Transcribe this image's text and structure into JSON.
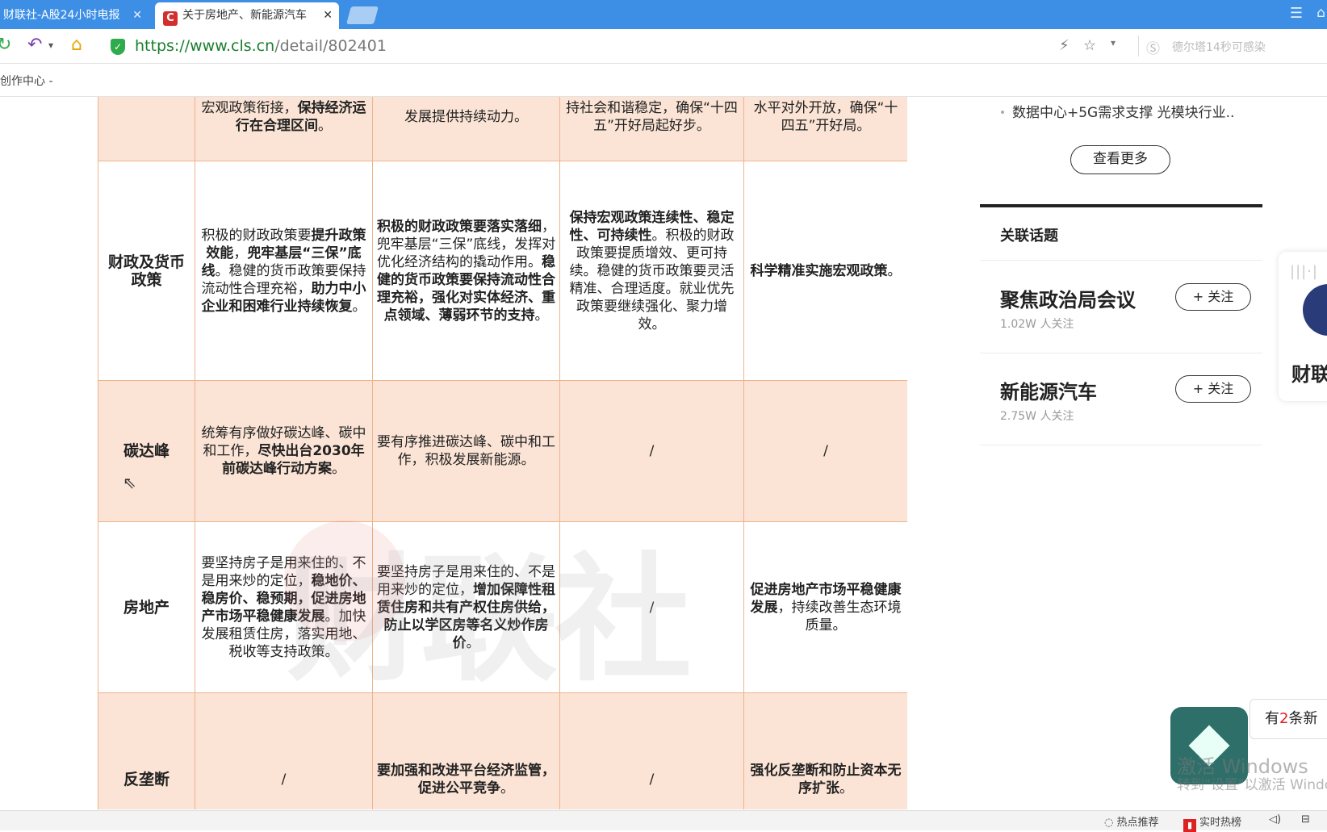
{
  "browser": {
    "tabs": [
      {
        "label": "财联社-A股24小时电报",
        "active": false
      },
      {
        "label": "关于房地产、新能源汽车",
        "active": true
      }
    ],
    "favicon_letter": "C",
    "url_scheme": "https://",
    "url_host": "www.cls.cn",
    "url_path": "/detail/802401",
    "address_hint": "德尔塔14秒可感染",
    "bookmark": "创作中心 -"
  },
  "table": {
    "rows": [
      {
        "label": "",
        "cells": [
          "宏观政策衔接，<b>保持经济运行在合理区间</b>。",
          "发展提供持续动力。",
          "持社会和谐稳定，确保“十四五”开好局起好步。",
          "水平对外开放，确保“十四五”开好局。"
        ],
        "shade": true
      },
      {
        "label": "财政及货币政策",
        "cells": [
          "积极的财政政策要<b>提升政策效能</b>，<b>兜牢基层“三保”底线</b>。稳健的货币政策要保持流动性合理充裕，<b>助力中小企业和困难行业持续恢复</b>。",
          "<b>积极的财政政策要落实落细</b>，兜牢基层“三保”底线，发挥对优化经济结构的撬动作用。<b>稳健的货币政策要保持流动性合理充裕，强化对实体经济、重点领域、薄弱环节的支持</b>。",
          "<b>保持宏观政策连续性、稳定性、可持续性</b>。积极的财政政策要提质增效、更可持续。稳健的货币政策要灵活精准、合理适度。就业优先政策要继续强化、聚力增效。",
          "<b>科学精准实施宏观政策</b>。"
        ],
        "shade": false
      },
      {
        "label": "碳达峰",
        "cells": [
          "统筹有序做好碳达峰、碳中和工作，<b>尽快出台2030年前碳达峰行动方案</b>。",
          "要有序推进碳达峰、碳中和工作，积极发展新能源。",
          "/",
          "/"
        ],
        "shade": true
      },
      {
        "label": "房地产",
        "cells": [
          "要坚持房子是用来住的、不是用来炒的定位，<b>稳地价、稳房价、稳预期，促进房地产市场平稳健康发展</b>。加快发展租赁住房，落实用地、税收等支持政策。",
          "要坚持房子是用来住的、不是用来炒的定位，<b>增加保障性租赁住房和共有产权住房供给，防止以学区房等名义炒作房价</b>。",
          "/",
          "<b>促进房地产市场平稳健康发展</b>，持续改善生态环境质量。"
        ],
        "shade": false
      },
      {
        "label": "反垄断",
        "cells": [
          "/",
          "<b>要加强和改进平台经济监管，促进公平竞争</b>。",
          "/",
          "<b>强化反垄断和防止资本无序扩张</b>。"
        ],
        "shade": true
      }
    ],
    "watermark": "财联社"
  },
  "sidebar": {
    "news_item": "数据中心+5G需求支撑 光模块行业..",
    "more_button": "查看更多",
    "topics_title": "关联话题",
    "topics": [
      {
        "name": "聚焦政治局会议",
        "followers": "1.02W 人关注",
        "follow": "+ 关注"
      },
      {
        "name": "新能源汽车",
        "followers": "2.75W 人关注",
        "follow": "+ 关注"
      }
    ],
    "float_label": "财联"
  },
  "notifications": {
    "notice_prefix": "有",
    "notice_count": "2",
    "notice_suffix": "条新",
    "activate_title": "激活 Windows",
    "activate_sub": "转到\"设置\"以激活 Windo"
  },
  "statusbar": {
    "hot_recommend": "热点推荐",
    "realtime_hot": "实时热榜"
  },
  "colors": {
    "tabbar": "#3d8fe6",
    "row_shade": "#fbe4d5",
    "table_border": "#f0b38a",
    "url_host": "#1a7f2e"
  }
}
